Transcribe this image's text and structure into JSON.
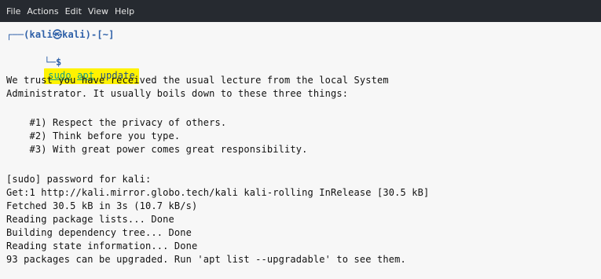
{
  "menubar": {
    "items": [
      "File",
      "Actions",
      "Edit",
      "View",
      "Help"
    ]
  },
  "terminal": {
    "prompt_top": "┌──(kali㉿kali)-[~]",
    "prompt_dollar": "└─$",
    "command": {
      "sudo": "sudo",
      "apt": "apt",
      "arg": "update"
    },
    "output": [
      "We trust you have received the usual lecture from the local System",
      "Administrator. It usually boils down to these three things:",
      "",
      "    #1) Respect the privacy of others.",
      "    #2) Think before you type.",
      "    #3) With great power comes great responsibility.",
      "",
      "[sudo] password for kali:",
      "Get:1 http://kali.mirror.globo.tech/kali kali-rolling InRelease [30.5 kB]",
      "Fetched 30.5 kB in 3s (10.7 kB/s)",
      "Reading package lists... Done",
      "Building dependency tree... Done",
      "Reading state information... Done",
      "93 packages can be upgraded. Run 'apt list --upgradable' to see them."
    ]
  },
  "colors": {
    "menubar_bg": "#262a30",
    "terminal_bg": "#f7f7f7",
    "highlight": "#fff200",
    "prompt_blue": "#2e60a8",
    "command_green": "#16a085"
  }
}
